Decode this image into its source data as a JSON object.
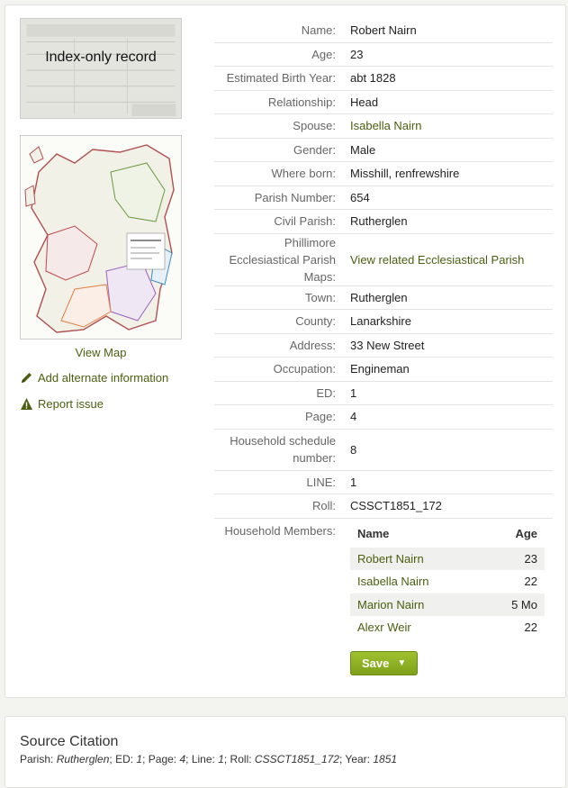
{
  "record_image": {
    "overlay": "Index-only record"
  },
  "sidebar": {
    "view_map": "View Map",
    "add_alternate": "Add alternate information",
    "report_issue": "Report issue"
  },
  "facts": [
    {
      "label": "Name:",
      "value": "Robert Nairn",
      "link": false
    },
    {
      "label": "Age:",
      "value": "23",
      "link": false
    },
    {
      "label": "Estimated Birth Year:",
      "value": "abt 1828",
      "link": false
    },
    {
      "label": "Relationship:",
      "value": "Head",
      "link": false
    },
    {
      "label": "Spouse:",
      "value": "Isabella Nairn",
      "link": true
    },
    {
      "label": "Gender:",
      "value": "Male",
      "link": false
    },
    {
      "label": "Where born:",
      "value": "Misshill, renfrewshire",
      "link": false
    },
    {
      "label": "Parish Number:",
      "value": "654",
      "link": false
    },
    {
      "label": "Civil Parish:",
      "value": "Rutherglen",
      "link": false
    },
    {
      "label": "Phillimore Ecclesiastical Parish Maps:",
      "value": "View related Ecclesiastical Parish",
      "link": true
    },
    {
      "label": "Town:",
      "value": "Rutherglen",
      "link": false
    },
    {
      "label": "County:",
      "value": "Lanarkshire",
      "link": false
    },
    {
      "label": "Address:",
      "value": "33 New Street",
      "link": false
    },
    {
      "label": "Occupation:",
      "value": "Engineman",
      "link": false
    },
    {
      "label": "ED:",
      "value": "1",
      "link": false
    },
    {
      "label": "Page:",
      "value": "4",
      "link": false
    },
    {
      "label": "Household schedule number:",
      "value": "8",
      "link": false
    },
    {
      "label": "LINE:",
      "value": "1",
      "link": false
    },
    {
      "label": "Roll:",
      "value": "CSSCT1851_172",
      "link": false
    }
  ],
  "household": {
    "label": "Household Members:",
    "headers": {
      "name": "Name",
      "age": "Age"
    },
    "members": [
      {
        "name": "Robert Nairn",
        "age": "23"
      },
      {
        "name": "Isabella Nairn",
        "age": "22"
      },
      {
        "name": "Marion Nairn",
        "age": "5 Mo"
      },
      {
        "name": "Alexr Weir",
        "age": "22"
      }
    ]
  },
  "save_button": "Save",
  "source": {
    "heading": "Source Citation",
    "parts": [
      {
        "label": "Parish: ",
        "value": "Rutherglen"
      },
      {
        "label": "; ED: ",
        "value": "1"
      },
      {
        "label": "; Page: ",
        "value": "4"
      },
      {
        "label": "; Line: ",
        "value": "1"
      },
      {
        "label": "; Roll: ",
        "value": "CSSCT1851_172"
      },
      {
        "label": "; Year: ",
        "value": "1851"
      }
    ]
  },
  "colors": {
    "link": "#4a5f0f",
    "button": "#8db026"
  }
}
